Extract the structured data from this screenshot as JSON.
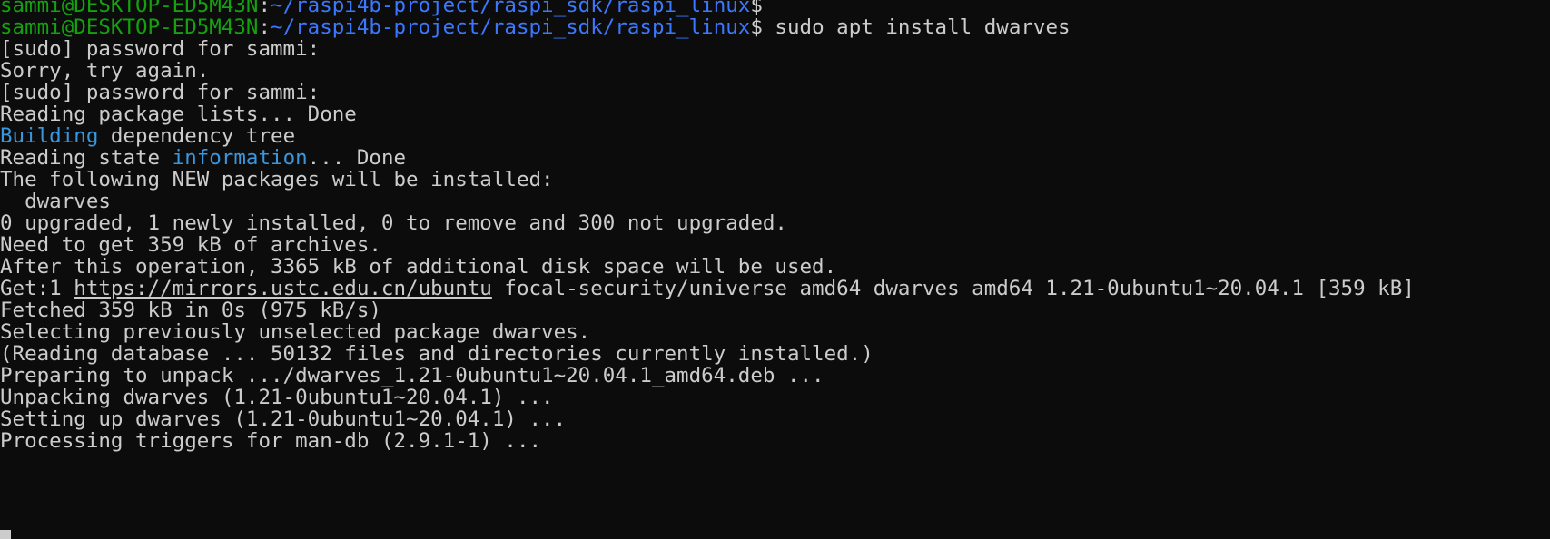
{
  "prompt": {
    "user_host": "sammi@DESKTOP-ED5M43N",
    "colon": ":",
    "path": "~/raspi4b-project/raspi_sdk/raspi_linux",
    "dollar": "$"
  },
  "lines": {
    "l1_cmd": "",
    "l2_cmd": " sudo apt install dwarves",
    "l3": "[sudo] password for sammi:",
    "l4": "Sorry, try again.",
    "l5": "[sudo] password for sammi:",
    "l6": "Reading package lists... Done",
    "l7_a": "Building",
    "l7_b": " dependency tree",
    "l8_a": "Reading state ",
    "l8_b": "information",
    "l8_c": "... Done",
    "l9": "The following NEW packages will be installed:",
    "l10": "  dwarves",
    "l11": "0 upgraded, 1 newly installed, 0 to remove and 300 not upgraded.",
    "l12": "Need to get 359 kB of archives.",
    "l13": "After this operation, 3365 kB of additional disk space will be used.",
    "l14_a": "Get:1 ",
    "l14_url": "https://mirrors.ustc.edu.cn/ubuntu",
    "l14_b": " focal-security/universe amd64 dwarves amd64 1.21-0ubuntu1~20.04.1 [359 kB]",
    "l15": "Fetched 359 kB in 0s (975 kB/s)",
    "l16": "Selecting previously unselected package dwarves.",
    "l17": "(Reading database ... 50132 files and directories currently installed.)",
    "l18": "Preparing to unpack .../dwarves_1.21-0ubuntu1~20.04.1_amd64.deb ...",
    "l19": "Unpacking dwarves (1.21-0ubuntu1~20.04.1) ...",
    "l20": "Setting up dwarves (1.21-0ubuntu1~20.04.1) ...",
    "l21": "Processing triggers for man-db (2.9.1-1) ..."
  },
  "colors": {
    "background": "#0c0c0c",
    "foreground": "#cccccc",
    "prompt_user": "#13a10e",
    "prompt_path": "#3b78ff",
    "highlight": "#3a96dd"
  }
}
